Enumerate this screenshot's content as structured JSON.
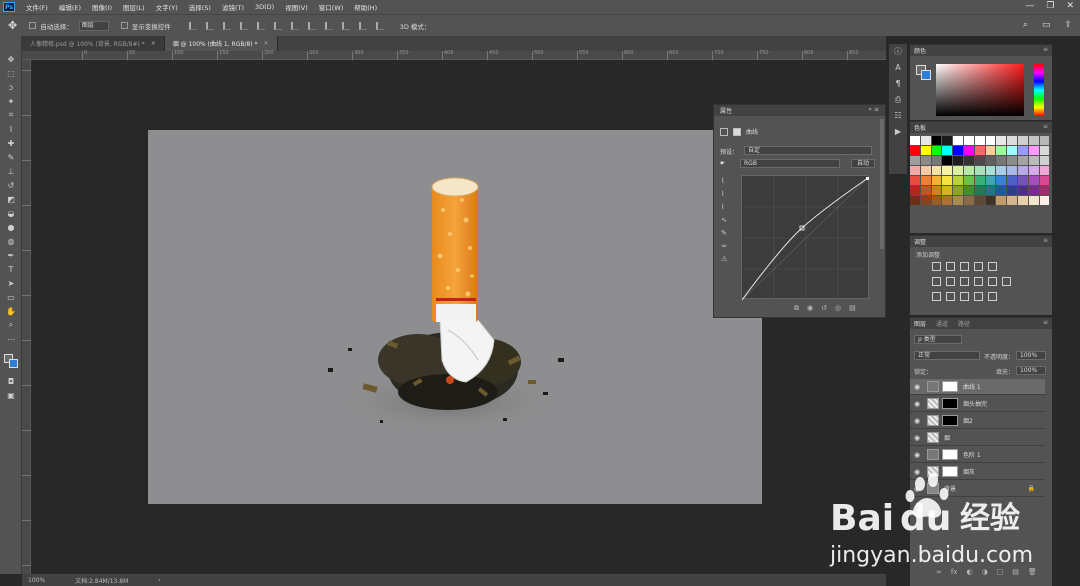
{
  "app": {
    "logo": "Ps"
  },
  "menu": [
    "文件(F)",
    "编辑(E)",
    "图像(I)",
    "图层(L)",
    "文字(Y)",
    "选择(S)",
    "滤镜(T)",
    "3D(D)",
    "视图(V)",
    "窗口(W)",
    "帮助(H)"
  ],
  "window_buttons": {
    "minimize": "—",
    "restore": "❐",
    "close": "✕"
  },
  "options": {
    "auto_select_label": "自动选择：",
    "auto_select_value": "图层",
    "show_transform_label": "显示变换控件",
    "mode_3d": "3D 模式：",
    "search_icon": "⌕",
    "workspace_icon": "▭",
    "share_icon": "⇪"
  },
  "tabs": [
    {
      "label": "人像精修.psd @ 100% (背景, RGB/8#) *",
      "close": "×"
    },
    {
      "label": "烟 @ 100% (曲线 1, RGB/8) *",
      "close": "×"
    }
  ],
  "rulers": {
    "h": [
      "0",
      "50",
      "100",
      "150",
      "200",
      "250",
      "300",
      "350",
      "400",
      "450",
      "500",
      "550",
      "600",
      "650",
      "700",
      "750",
      "800",
      "850",
      "900",
      "950"
    ]
  },
  "status": {
    "zoom": "100%",
    "doc": "文档:2.84M/13.8M",
    "arrow": "›"
  },
  "properties": {
    "title": "属性",
    "collapse": "»",
    "menu": "≡",
    "sub_title": "曲线",
    "preset_label": "预设：",
    "preset_value": "自定",
    "channel_value": "RGB",
    "auto_label": "自动"
  },
  "color_panel": {
    "title": "颜色"
  },
  "swatches_panel": {
    "title": "色板",
    "colors": [
      "#ffffff",
      "#e6e6e6",
      "#000000",
      "#1a1a1a",
      "#ffffff",
      "#ffffff",
      "#ffffff",
      "#ffffff",
      "#e8e8e8",
      "#dcdcdc",
      "#cfcfcf",
      "#c4c4c4",
      "#b8b8b8",
      "#ff0000",
      "#ffff00",
      "#00ff00",
      "#00ffff",
      "#0000ff",
      "#ff00ff",
      "#ff6666",
      "#ffcc99",
      "#99ff99",
      "#99ffff",
      "#9999ff",
      "#ff99ff",
      "#d9d9d9",
      "#9e9e9e",
      "#8a8a8a",
      "#777777",
      "#000000",
      "#1e1e1e",
      "#333333",
      "#4a4a4a",
      "#606060",
      "#777777",
      "#8d8d8d",
      "#a3a3a3",
      "#bababa",
      "#d0d0d0",
      "#f4a9a9",
      "#f7c8a5",
      "#f8e2a2",
      "#f8f5a2",
      "#d9f2a2",
      "#b7e8a5",
      "#a7e1b9",
      "#a7dfd9",
      "#a7cfe9",
      "#a8b8e9",
      "#b8a8e9",
      "#d9a8e9",
      "#f0a8d9",
      "#e84c3d",
      "#ef7e39",
      "#f3b13b",
      "#f7e23f",
      "#b9d43a",
      "#6fc04a",
      "#3cae7a",
      "#39a9b1",
      "#3b84c9",
      "#4b5fc4",
      "#7450c1",
      "#a84cbe",
      "#d64a93",
      "#b5271b",
      "#c1561e",
      "#c9851f",
      "#d6b521",
      "#8aa61e",
      "#3f8f2c",
      "#1c7d52",
      "#197a83",
      "#1b5b9c",
      "#2b3c98",
      "#4d2d95",
      "#7a2a92",
      "#a52a6a",
      "#6e2f17",
      "#86441f",
      "#9b5a26",
      "#ab7231",
      "#a98a55",
      "#8a6c44",
      "#5e4a34",
      "#3d3226",
      "#c29b6b",
      "#d6b58a",
      "#e8cfae",
      "#f3e4cf",
      "#faf2e6"
    ]
  },
  "adjustments_panel": {
    "title": "调整",
    "subtitle": "添加调整"
  },
  "layers_panel": {
    "tabs": [
      "图层",
      "通道",
      "路径"
    ],
    "filter_value": "ρ 类型",
    "blend_value": "正常",
    "opacity_label": "不透明度：",
    "opacity_value": "100%",
    "lock_label": "锁定：",
    "fill_label": "填充：",
    "fill_value": "100%",
    "layers": [
      {
        "name": "曲线 1",
        "selected": true
      },
      {
        "name": "烟头抽完",
        "selected": false
      },
      {
        "name": "烟2",
        "selected": false
      },
      {
        "name": "烟",
        "selected": false
      },
      {
        "name": "色阶 1",
        "selected": false
      },
      {
        "name": "烟灰",
        "selected": false
      },
      {
        "name": "背景",
        "selected": false
      }
    ],
    "bottom_icons": [
      "∞",
      "fx",
      "◐",
      "◑",
      "▢",
      "▤",
      "🗑"
    ]
  },
  "watermark": {
    "brand": "Bai",
    "brand_du": "du",
    "cn": "经验",
    "url": "jingyan.baidu.com"
  }
}
